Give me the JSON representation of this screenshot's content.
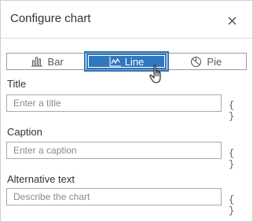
{
  "dialog": {
    "title": "Configure chart",
    "close_icon": "close-icon"
  },
  "chart_type": {
    "selected": "Line",
    "options": [
      {
        "label": "Bar",
        "icon": "bar-chart-icon"
      },
      {
        "label": "Line",
        "icon": "line-chart-icon"
      },
      {
        "label": "Pie",
        "icon": "pie-chart-icon"
      }
    ]
  },
  "fields": {
    "title": {
      "label": "Title",
      "placeholder": "Enter a title",
      "value": "",
      "expression_label": "{ }"
    },
    "caption": {
      "label": "Caption",
      "placeholder": "Enter a caption",
      "value": "",
      "expression_label": "{ }"
    },
    "alt_text": {
      "label": "Alternative text",
      "placeholder": "Describe the chart",
      "value": "",
      "expression_label": "{ }"
    }
  },
  "colors": {
    "accent": "#2f78c0",
    "border": "#a9a9a9"
  },
  "cursor": "hand-pointer-icon"
}
